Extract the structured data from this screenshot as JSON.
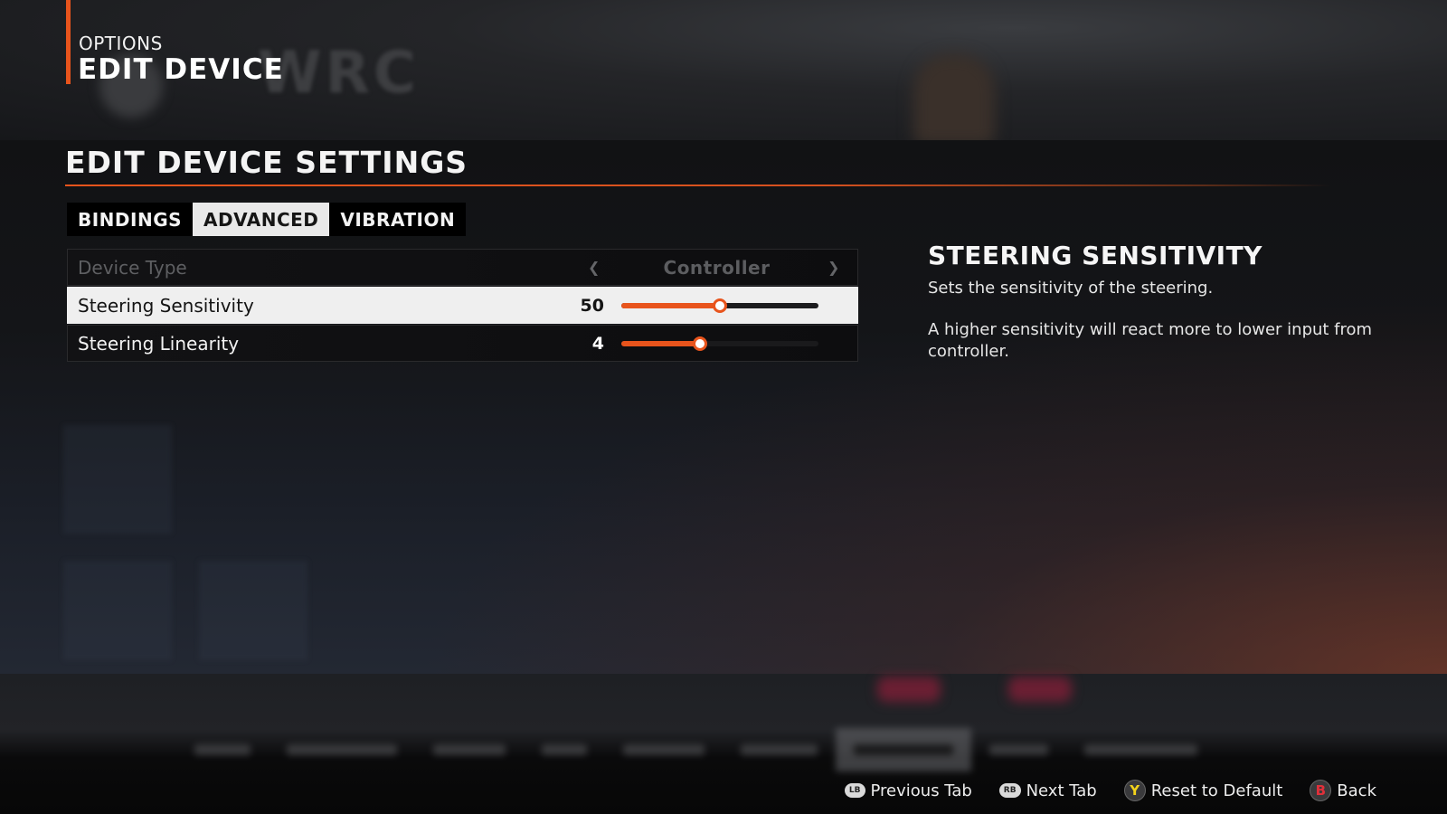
{
  "header": {
    "subtitle": "OPTIONS",
    "title": "EDIT DEVICE",
    "background_logo": "WRC"
  },
  "section": {
    "title": "EDIT DEVICE SETTINGS"
  },
  "tabs": [
    {
      "label": "BINDINGS",
      "active": false
    },
    {
      "label": "ADVANCED",
      "active": true
    },
    {
      "label": "VIBRATION",
      "active": false
    }
  ],
  "settings": {
    "device_type": {
      "label": "Device Type",
      "value": "Controller",
      "disabled": true,
      "left_icon": "chevron-left-icon",
      "right_icon": "chevron-right-icon"
    },
    "steering_sensitivity": {
      "label": "Steering Sensitivity",
      "value": "50",
      "fill_fraction": 0.5,
      "selected": true
    },
    "steering_linearity": {
      "label": "Steering Linearity",
      "value": "4",
      "fill_fraction": 0.4,
      "selected": false
    }
  },
  "info": {
    "title": "STEERING SENSITIVITY",
    "description": "Sets the sensitivity of the steering.",
    "detail": "A higher sensitivity will react more to lower input from controller."
  },
  "footer_hints": [
    {
      "button": "LB",
      "label": "Previous Tab",
      "icon": "lb-button-icon"
    },
    {
      "button": "RB",
      "label": "Next Tab",
      "icon": "rb-button-icon"
    },
    {
      "button": "Y",
      "label": "Reset to Default",
      "icon": "y-button-icon",
      "color": "#f2d21b"
    },
    {
      "button": "B",
      "label": "Back",
      "icon": "b-button-icon",
      "color": "#e0303a"
    }
  ],
  "colors": {
    "accent": "#e8541c",
    "selected_row": "#efefef",
    "tab_active": "#e9e9e9"
  }
}
